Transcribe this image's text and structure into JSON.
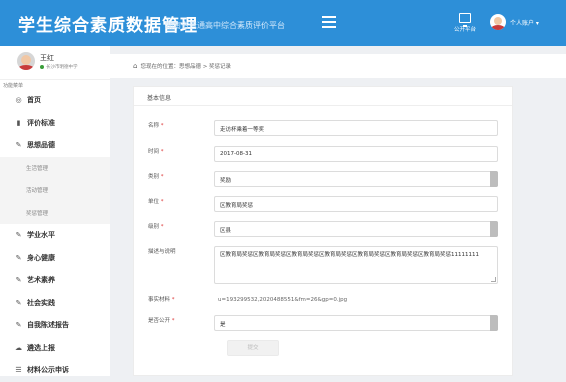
{
  "header": {
    "app_title": "学生综合素质数据管理",
    "app_subtitle": "湖南省普通高中综合素质评价平台",
    "menu_icon": "hamburger-icon",
    "public_platform_label": "公开平台",
    "account_label": "个人账户 ▾"
  },
  "user": {
    "name": "王红",
    "school": "长沙市明德中学"
  },
  "sidebar": {
    "menu_header": "功能菜单",
    "items": [
      {
        "label": "首页",
        "icon": "dashboard-icon",
        "glyph": "◎"
      },
      {
        "label": "评价标准",
        "icon": "book-icon",
        "glyph": "▮"
      },
      {
        "label": "思想品德",
        "icon": "edit-icon",
        "glyph": "✎"
      }
    ],
    "sub_items": [
      {
        "label": "生活管理"
      },
      {
        "label": "活动管理"
      },
      {
        "label": "奖惩管理"
      }
    ],
    "items_after": [
      {
        "label": "学业水平",
        "icon": "edit-icon",
        "glyph": "✎"
      },
      {
        "label": "身心健康",
        "icon": "edit-icon",
        "glyph": "✎"
      },
      {
        "label": "艺术素养",
        "icon": "edit-icon",
        "glyph": "✎"
      },
      {
        "label": "社会实践",
        "icon": "edit-icon",
        "glyph": "✎"
      },
      {
        "label": "自我陈述报告",
        "icon": "edit-icon",
        "glyph": "✎"
      },
      {
        "label": "遴选上报",
        "icon": "cloud-upload-icon",
        "glyph": "☁"
      },
      {
        "label": "材料公示申诉",
        "icon": "list-icon",
        "glyph": "☰"
      }
    ]
  },
  "breadcrumb": {
    "text": "您现在的位置：思想品德 > 奖惩记录"
  },
  "form": {
    "section_title": "基本信息",
    "fields": {
      "name": {
        "label": "名称",
        "value": "走访杯乘着一等奖"
      },
      "time": {
        "label": "时间",
        "value": "2017-08-31"
      },
      "category": {
        "label": "类别",
        "value": "奖励"
      },
      "unit": {
        "label": "单位",
        "value": "区教育局奖惩"
      },
      "level": {
        "label": "级别",
        "value": "区县"
      },
      "description": {
        "label": "描述与说明",
        "value": "区教育局奖惩区教育局奖惩区教育局奖惩区教育局奖惩区教育局奖惩区教育局奖惩区教育局奖惩11111111"
      },
      "evidence": {
        "label": "事实材料",
        "value": "u=193299532,2020488551&fm=26&gp=0.jpg"
      },
      "public": {
        "label": "是否公开",
        "value": "是"
      }
    },
    "required_mark": "*",
    "submit_label": "提交"
  }
}
